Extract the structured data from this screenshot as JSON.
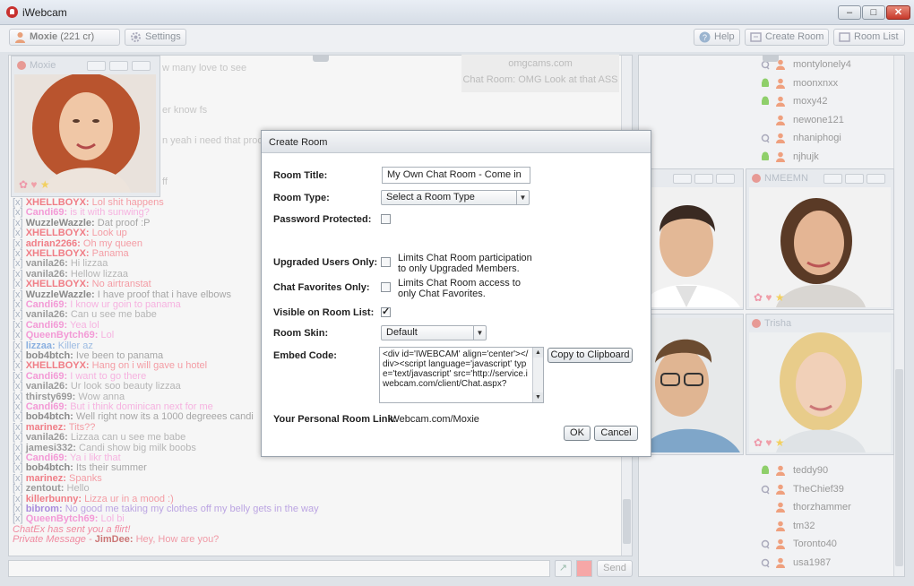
{
  "app": {
    "title": "iWebcam"
  },
  "toolbar": {
    "user_name": "Moxie",
    "user_credits": "(221 cr)",
    "settings_label": "Settings",
    "help_label": "Help",
    "create_room_label": "Create Room",
    "room_list_label": "Room List"
  },
  "topic": {
    "site": "omgcams.com",
    "room": "Chat Room: OMG Look at that ASS"
  },
  "background_fragments": [
    "w many love to see",
    "er know fs",
    "n yeah i need that proof",
    "ff"
  ],
  "chat": [
    {
      "name": "XHELLBOYX:",
      "msg": "Lol shit happens",
      "style": "red"
    },
    {
      "name": "Candi69:",
      "msg": "is it with sunwing?",
      "style": "pink"
    },
    {
      "name": "WuzzleWazzle:",
      "msg": "Dat proof :P",
      "style": "dark"
    },
    {
      "name": "XHELLBOYX:",
      "msg": "Look up",
      "style": "red"
    },
    {
      "name": "adrian2266:",
      "msg": "Oh my queen",
      "style": "red"
    },
    {
      "name": "XHELLBOYX:",
      "msg": "Panama",
      "style": "red"
    },
    {
      "name": "vanila26:",
      "msg": "Hi lizzaa",
      "style": "gray"
    },
    {
      "name": "vanila26:",
      "msg": "Hellow lizzaa",
      "style": "gray"
    },
    {
      "name": "XHELLBOYX:",
      "msg": "No airtranstat",
      "style": "red"
    },
    {
      "name": "WuzzleWazzle:",
      "msg": "I have proof that i have elbows",
      "style": "dark"
    },
    {
      "name": "Candi69:",
      "msg": "I know ur goin to panama",
      "style": "pink"
    },
    {
      "name": "vanila26:",
      "msg": "Can u see me babe",
      "style": "gray"
    },
    {
      "name": "Candi69:",
      "msg": "Yea lol",
      "style": "pink"
    },
    {
      "name": "QueenBytch69:",
      "msg": "Lol",
      "style": "pink"
    },
    {
      "name": "lizzaa:",
      "msg": "Killer az",
      "style": "blue"
    },
    {
      "name": "bob4btch:",
      "msg": "Ive been to panama",
      "style": "dark"
    },
    {
      "name": "XHELLBOYX:",
      "msg": "Hang on i will gave u hotel",
      "style": "red"
    },
    {
      "name": "Candi69:",
      "msg": "I want to go there",
      "style": "pink"
    },
    {
      "name": "vanila26:",
      "msg": "Ur look soo beauty lizzaa",
      "style": "gray"
    },
    {
      "name": "thirsty699:",
      "msg": "Wow anna",
      "style": "gray"
    },
    {
      "name": "Candi69:",
      "msg": "But i think dominican next for me",
      "style": "pink"
    },
    {
      "name": "bob4btch:",
      "msg": "Well right now its a 1000 degreees candi",
      "style": "dark"
    },
    {
      "name": "marinez:",
      "msg": "Tits??",
      "style": "red"
    },
    {
      "name": "vanila26:",
      "msg": "Lizzaa can u see me babe",
      "style": "gray"
    },
    {
      "name": "jamesi332:",
      "msg": "Candi show big milk boobs",
      "style": "gray"
    },
    {
      "name": "Candi69:",
      "msg": "Ya i likr that",
      "style": "pink"
    },
    {
      "name": "bob4btch:",
      "msg": "Its their summer",
      "style": "dark"
    },
    {
      "name": "marinez:",
      "msg": "Spanks",
      "style": "red"
    },
    {
      "name": "zentout:",
      "msg": "Hello",
      "style": "gray"
    },
    {
      "name": "killerbunny:",
      "msg": "Lizza ur in a mood :)",
      "style": "red"
    },
    {
      "name": "bibrom:",
      "msg": "No good me taking my clothes off my belly gets in the way",
      "style": "purple"
    },
    {
      "name": "QueenBytch69:",
      "msg": "Lol bi",
      "style": "pink"
    }
  ],
  "system_msg": "ChatEx has sent you a flirt!",
  "private_msg": {
    "label": "Private Message",
    "sep": " - ",
    "name": "JimDee:",
    "text": " Hey, How are you?"
  },
  "chat_prefix": "[x]",
  "cam_self": {
    "name": "Moxie"
  },
  "cam_2": {
    "name": "NMEEMN"
  },
  "cam_3": {
    "name": "Trisha"
  },
  "users_top": [
    {
      "name": "montylonely4",
      "device": "mic"
    },
    {
      "name": "moonxnxx",
      "device": "android"
    },
    {
      "name": "moxy42",
      "device": "android"
    },
    {
      "name": "newone121",
      "device": "none"
    },
    {
      "name": "nhaniphogi",
      "device": "mic"
    },
    {
      "name": "njhujk",
      "device": "android"
    }
  ],
  "users_bottom": [
    {
      "name": "teddy90",
      "device": "android"
    },
    {
      "name": "TheChief39",
      "device": "mic"
    },
    {
      "name": "thorzhammer",
      "device": "none"
    },
    {
      "name": "tm32",
      "device": "none"
    },
    {
      "name": "Toronto40",
      "device": "mic"
    },
    {
      "name": "usa1987",
      "device": "mic"
    }
  ],
  "input": {
    "send_label": "Send"
  },
  "dialog": {
    "title": "Create Room",
    "room_title_label": "Room Title:",
    "room_title_value": "My Own Chat Room - Come in",
    "room_type_label": "Room Type:",
    "room_type_value": "Select a Room Type",
    "password_label": "Password Protected:",
    "upgraded_label": "Upgraded Users Only:",
    "upgraded_hint": "Limits Chat Room participation to only Upgraded Members.",
    "favorites_label": "Chat Favorites Only:",
    "favorites_hint": "Limits Chat Room access to only Chat Favorites.",
    "visible_label": "Visible on Room List:",
    "skin_label": "Room Skin:",
    "skin_value": "Default",
    "embed_label": "Embed Code:",
    "embed_value": "<div id='IWEBCAM' align='center'></div><script language='javascript' type='text/javascript' src='http://service.iwebcam.com/client/Chat.aspx?",
    "copy_label": "Copy to Clipboard",
    "link_label": "Your Personal Room Link:",
    "link_value": "iWebcam.com/Moxie",
    "ok_label": "OK",
    "cancel_label": "Cancel",
    "password_checked": false,
    "upgraded_checked": false,
    "favorites_checked": false,
    "visible_checked": true
  }
}
